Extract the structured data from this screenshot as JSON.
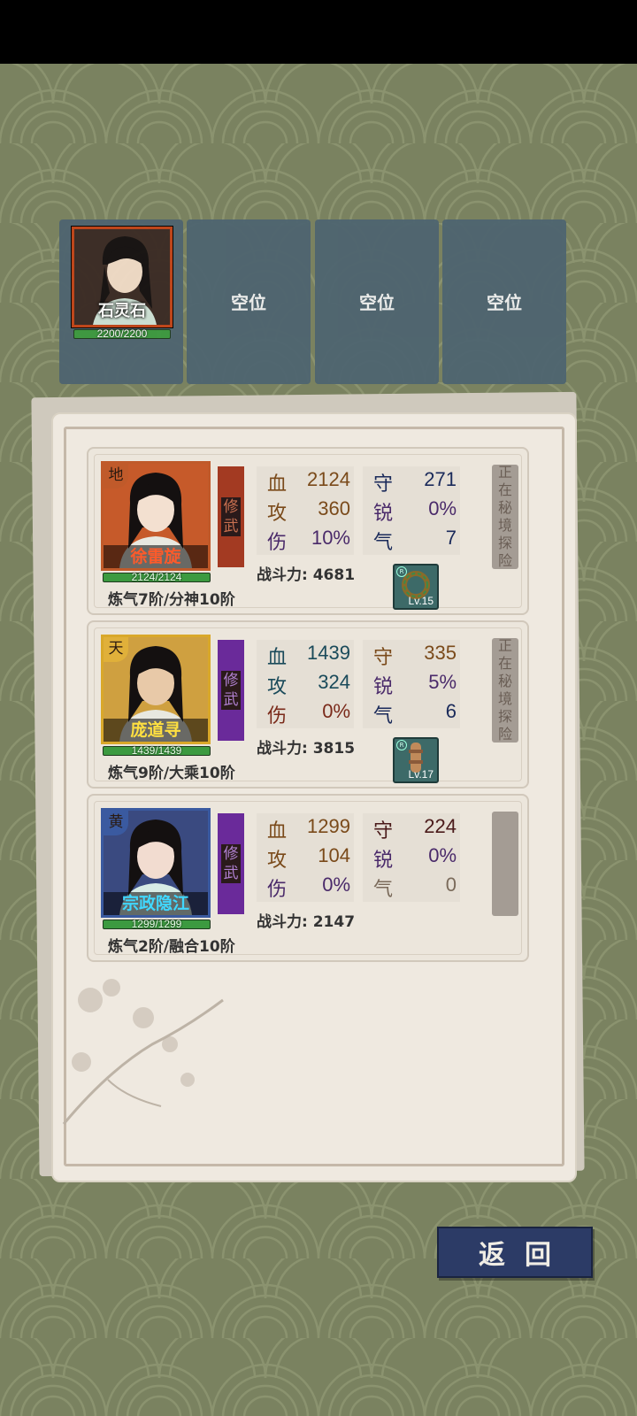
{
  "team": {
    "leader": {
      "name": "石灵石",
      "hp": "2200/2200"
    },
    "slots": [
      "空位",
      "空位",
      "空位"
    ]
  },
  "members": [
    {
      "grade": "地",
      "grade_color": "#c05a2a",
      "name": "徐雷旋",
      "name_color": "#ff5a2a",
      "frame_color": "#c05a2a",
      "hp": "2124/2124",
      "class_tag": [
        "修",
        "武"
      ],
      "class_color": "#a33a22",
      "class_text_color": "#c87050",
      "stats_left": [
        {
          "k": "血",
          "v": "2124"
        },
        {
          "k": "攻",
          "v": "360"
        },
        {
          "k": "伤",
          "v": "10%"
        }
      ],
      "stats_right": [
        {
          "k": "守",
          "v": "271"
        },
        {
          "k": "锐",
          "v": "0%"
        },
        {
          "k": "气",
          "v": "7"
        }
      ],
      "power": "战斗力: 4681",
      "realm": "炼气7阶/分神10阶",
      "equip_icon": "ring-equipment-icon",
      "equip_lv": "Lv.15",
      "status": [
        "正",
        "在",
        "秘",
        "境",
        "探",
        "险"
      ]
    },
    {
      "grade": "天",
      "grade_color": "#e0b03a",
      "name": "庞道寻",
      "name_color": "#ffe040",
      "frame_color": "#d9a82a",
      "hp": "1439/1439",
      "class_tag": [
        "修",
        "武"
      ],
      "class_color": "#6a2a9a",
      "class_text_color": "#b080d0",
      "stats_left": [
        {
          "k": "血",
          "v": "1439"
        },
        {
          "k": "攻",
          "v": "324"
        },
        {
          "k": "伤",
          "v": "0%"
        }
      ],
      "stats_right": [
        {
          "k": "守",
          "v": "335"
        },
        {
          "k": "锐",
          "v": "5%"
        },
        {
          "k": "气",
          "v": "6"
        }
      ],
      "power": "战斗力: 3815",
      "realm": "炼气9阶/大乘10阶",
      "equip_icon": "bracer-equipment-icon",
      "equip_lv": "Lv.17",
      "status": [
        "正",
        "在",
        "秘",
        "境",
        "探",
        "险"
      ]
    },
    {
      "grade": "黄",
      "grade_color": "#3a5aa0",
      "name": "宗政隐江",
      "name_color": "#40d8ff",
      "frame_color": "#3a5aa0",
      "hp": "1299/1299",
      "class_tag": [
        "修",
        "武"
      ],
      "class_color": "#6a2a9a",
      "class_text_color": "#b080d0",
      "stats_left": [
        {
          "k": "血",
          "v": "1299"
        },
        {
          "k": "攻",
          "v": "104"
        },
        {
          "k": "伤",
          "v": "0%"
        }
      ],
      "stats_right": [
        {
          "k": "守",
          "v": "224"
        },
        {
          "k": "锐",
          "v": "0%"
        },
        {
          "k": "气",
          "v": "0"
        }
      ],
      "power": "战斗力: 2147",
      "realm": "炼气2阶/融合10阶",
      "equip_icon": "",
      "equip_lv": "",
      "status": []
    }
  ],
  "colors": {
    "hp_color": "#7a4a1a",
    "atk_color": "#7a4a1a",
    "dmg_color": "#4a2a6a",
    "def_color": "#1a2a5a",
    "sharp_color": "#4a2a6a",
    "qi_color": "#1a2a5a"
  },
  "back_button": "返回"
}
